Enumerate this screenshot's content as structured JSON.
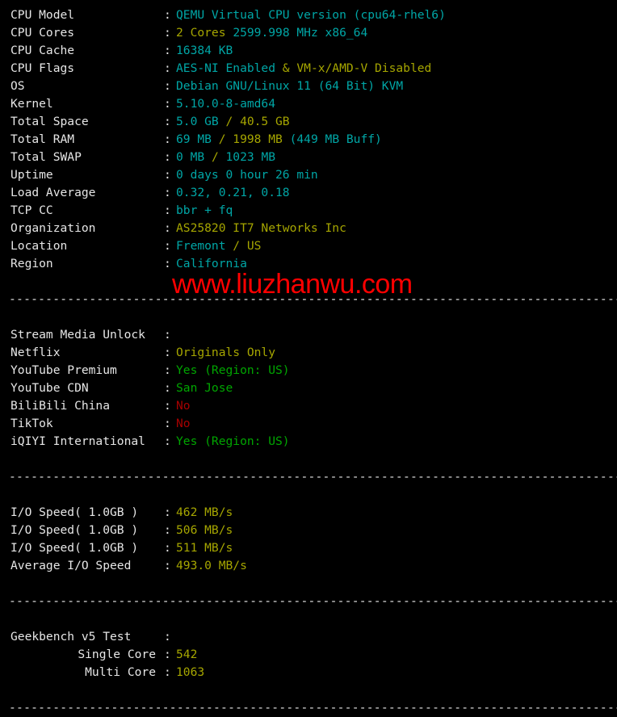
{
  "terminal": {
    "background": "#000000",
    "colors": {
      "label": "#e6e6e6",
      "cyan": "#00a6a6",
      "yellow": "#a6a600",
      "green": "#00a600",
      "red": "#a60000",
      "watermark": "#ff0000"
    },
    "separator": "-------------------------------------------------------------------------------------"
  },
  "watermark": {
    "text": "www.liuzhanwu.com"
  },
  "sections": [
    {
      "name": "system-info",
      "rows": [
        {
          "label": "CPU Model",
          "colon": ":",
          "parts": [
            {
              "text": "QEMU Virtual CPU version (cpu64-rhel6)",
              "color": "cyan"
            }
          ]
        },
        {
          "label": "CPU Cores",
          "colon": ":",
          "parts": [
            {
              "text": "2 Cores",
              "color": "yellow"
            },
            {
              "text": " ",
              "color": "white"
            },
            {
              "text": "2599.998 MHz x86_64",
              "color": "cyan"
            }
          ]
        },
        {
          "label": "CPU Cache",
          "colon": ":",
          "parts": [
            {
              "text": "16384 KB",
              "color": "cyan"
            }
          ]
        },
        {
          "label": "CPU Flags",
          "colon": ":",
          "parts": [
            {
              "text": "AES-NI Enabled",
              "color": "cyan"
            },
            {
              "text": " & ",
              "color": "yellow"
            },
            {
              "text": "VM-x/AMD-V Disabled",
              "color": "yellow"
            }
          ]
        },
        {
          "label": "OS",
          "colon": ":",
          "parts": [
            {
              "text": "Debian GNU/Linux 11 (64 Bit) KVM",
              "color": "cyan"
            }
          ]
        },
        {
          "label": "Kernel",
          "colon": ":",
          "parts": [
            {
              "text": "5.10.0-8-amd64",
              "color": "cyan"
            }
          ]
        },
        {
          "label": "Total Space",
          "colon": ":",
          "parts": [
            {
              "text": "5.0 GB",
              "color": "cyan"
            },
            {
              "text": " / ",
              "color": "yellow"
            },
            {
              "text": "40.5 GB",
              "color": "yellow"
            }
          ]
        },
        {
          "label": "Total RAM",
          "colon": ":",
          "parts": [
            {
              "text": "69 MB",
              "color": "cyan"
            },
            {
              "text": " / ",
              "color": "yellow"
            },
            {
              "text": "1998 MB",
              "color": "yellow"
            },
            {
              "text": " (449 MB Buff)",
              "color": "cyan"
            }
          ]
        },
        {
          "label": "Total SWAP",
          "colon": ":",
          "parts": [
            {
              "text": "0 MB",
              "color": "cyan"
            },
            {
              "text": " / ",
              "color": "yellow"
            },
            {
              "text": "1023 MB",
              "color": "cyan"
            }
          ]
        },
        {
          "label": "Uptime",
          "colon": ":",
          "parts": [
            {
              "text": "0 days 0 hour 26 min",
              "color": "cyan"
            }
          ]
        },
        {
          "label": "Load Average",
          "colon": ":",
          "parts": [
            {
              "text": "0.32, 0.21, 0.18",
              "color": "cyan"
            }
          ]
        },
        {
          "label": "TCP CC",
          "colon": ":",
          "parts": [
            {
              "text": "bbr + fq",
              "color": "cyan"
            }
          ]
        },
        {
          "label": "Organization",
          "colon": ":",
          "parts": [
            {
              "text": "AS25820 IT7 Networks Inc",
              "color": "yellow"
            }
          ]
        },
        {
          "label": "Location",
          "colon": ":",
          "parts": [
            {
              "text": "Fremont",
              "color": "cyan"
            },
            {
              "text": " / US",
              "color": "yellow"
            }
          ]
        },
        {
          "label": "Region",
          "colon": ":",
          "parts": [
            {
              "text": "California",
              "color": "cyan"
            }
          ]
        }
      ]
    },
    {
      "name": "stream-media-unlock",
      "rows": [
        {
          "label": "Stream Media Unlock",
          "colon": ":",
          "parts": []
        },
        {
          "label": "Netflix",
          "colon": ":",
          "parts": [
            {
              "text": "Originals Only",
              "color": "yellow"
            }
          ]
        },
        {
          "label": "YouTube Premium",
          "colon": ":",
          "parts": [
            {
              "text": "Yes (Region: US)",
              "color": "green"
            }
          ]
        },
        {
          "label": "YouTube CDN",
          "colon": ":",
          "parts": [
            {
              "text": "San Jose",
              "color": "green"
            }
          ]
        },
        {
          "label": "BiliBili China",
          "colon": ":",
          "parts": [
            {
              "text": "No",
              "color": "red"
            }
          ]
        },
        {
          "label": "TikTok",
          "colon": ":",
          "parts": [
            {
              "text": "No",
              "color": "red"
            }
          ]
        },
        {
          "label": "iQIYI International",
          "colon": ":",
          "parts": [
            {
              "text": "Yes (Region: US)",
              "color": "green"
            }
          ]
        }
      ]
    },
    {
      "name": "io-speed",
      "rows": [
        {
          "label": "I/O Speed( 1.0GB )",
          "colon": ":",
          "parts": [
            {
              "text": "462 MB/s",
              "color": "yellow"
            }
          ]
        },
        {
          "label": "I/O Speed( 1.0GB )",
          "colon": ":",
          "parts": [
            {
              "text": "506 MB/s",
              "color": "yellow"
            }
          ]
        },
        {
          "label": "I/O Speed( 1.0GB )",
          "colon": ":",
          "parts": [
            {
              "text": "511 MB/s",
              "color": "yellow"
            }
          ]
        },
        {
          "label": "Average I/O Speed",
          "colon": ":",
          "parts": [
            {
              "text": "493.0 MB/s",
              "color": "yellow"
            }
          ]
        }
      ]
    },
    {
      "name": "geekbench",
      "rows": [
        {
          "label": "Geekbench v5 Test",
          "colon": ":",
          "parts": []
        },
        {
          "label": "Single Core",
          "indent": true,
          "colon": ":",
          "parts": [
            {
              "text": "542",
              "color": "yellow"
            }
          ]
        },
        {
          "label": "Multi Core",
          "indent": true,
          "colon": ":",
          "parts": [
            {
              "text": "1063",
              "color": "yellow"
            }
          ]
        }
      ]
    }
  ]
}
